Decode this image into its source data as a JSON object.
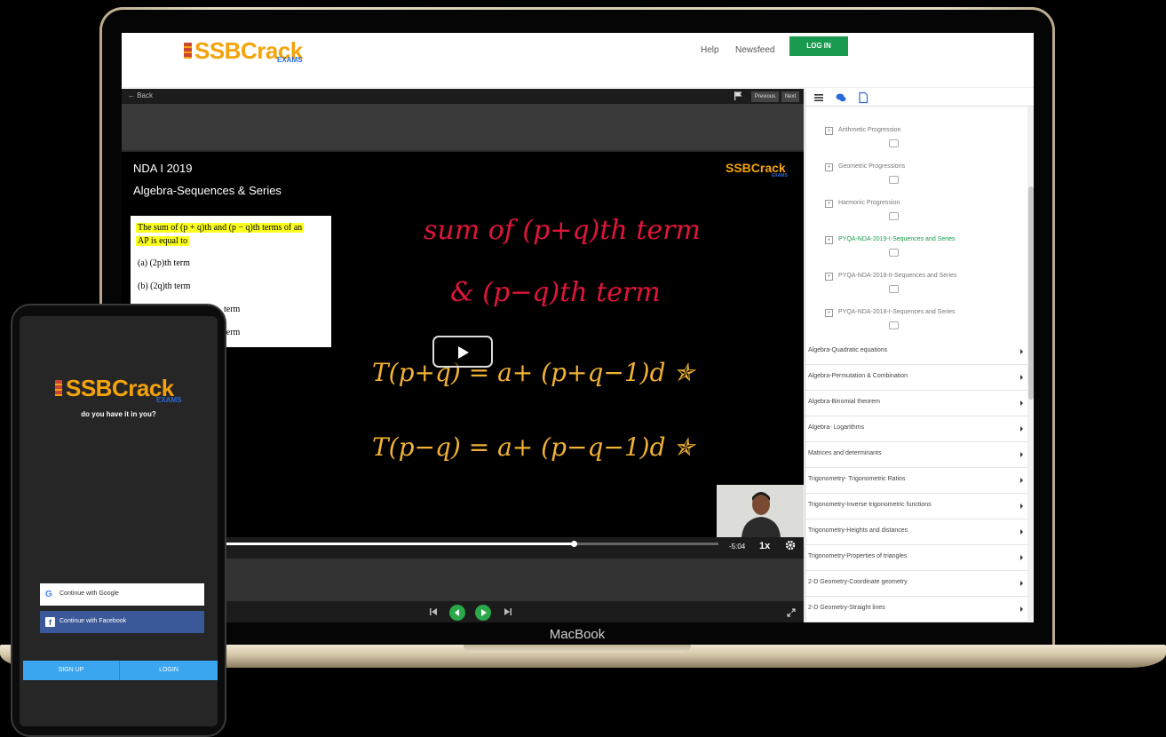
{
  "device": {
    "brand_label": "MacBook"
  },
  "site": {
    "logo_text": "SSBCrack",
    "logo_sub": "EXAMS",
    "nav": {
      "help": "Help",
      "newsfeed": "Newsfeed",
      "login": "LOG IN"
    }
  },
  "player": {
    "back_label": "← Back",
    "previous_label": "Previous",
    "next_label": "Next",
    "exam": "NDA I 2019",
    "topic": "Algebra-Sequences & Series",
    "watermark_logo": "SSBCrack",
    "watermark_sub": "EXAMS",
    "question": {
      "line1": "The sum of (p + q)th and (p − q)th terms of an",
      "line2": "AP is equal to",
      "options": [
        "(a)  (2p)th term",
        "(b)  (2q)th term",
        "term",
        "term"
      ]
    },
    "board": {
      "lines": [
        "sum of  (p+q)th term",
        "&        (p−q)th term",
        "T(p+q)  =  a+ (p+q−1)d ✯",
        "T(p−q)  =  a+ (p−q−1)d ✯"
      ]
    },
    "progress": 0.72,
    "time": "-5:04",
    "speed": "1x"
  },
  "sidebar": {
    "sub_items": [
      {
        "label": "Arithmetic Progression",
        "active": false
      },
      {
        "label": "Geometric Progressions",
        "active": false
      },
      {
        "label": "Harmonic Progression",
        "active": false
      },
      {
        "label": "PYQA-NDA-2019-I-Sequences and Series",
        "active": true
      },
      {
        "label": "PYQA-NDA-2018-II-Sequences and Series",
        "active": false
      },
      {
        "label": "PYQA-NDA-2018-I-Sequences and Series",
        "active": false
      }
    ],
    "categories": [
      "Algebra-Quadratic equations",
      "Algebra-Permutation & Combination",
      "Algebra-Binomial theorem",
      "Algebra- Logarithms",
      "Matrices and determinants",
      "Trigonometry- Trigonometric Ratios",
      "Trigonometry-Inverse trigonometric functions",
      "Trigonometry-Heights and distances",
      "Trigonometry-Properties of triangles",
      "2-D Geometry-Coordinate geometry",
      "2-D Geometry-Straight lines"
    ]
  },
  "phone": {
    "logo_text": "SSBCrack",
    "logo_sub": "EXAMS",
    "tagline": "do you have it in you?",
    "google_label": "Continue with Google",
    "facebook_label": "Continue with Facebook",
    "signup_label": "SIGN UP",
    "login_label": "LOGIN"
  },
  "colors": {
    "brand_orange": "#f5a30a",
    "brand_green": "#1a9a4e",
    "facebook_blue": "#3b5998",
    "signup_bar": "#3aa6f0",
    "board_red": "#e0153a",
    "board_yellow": "#f2b233"
  }
}
